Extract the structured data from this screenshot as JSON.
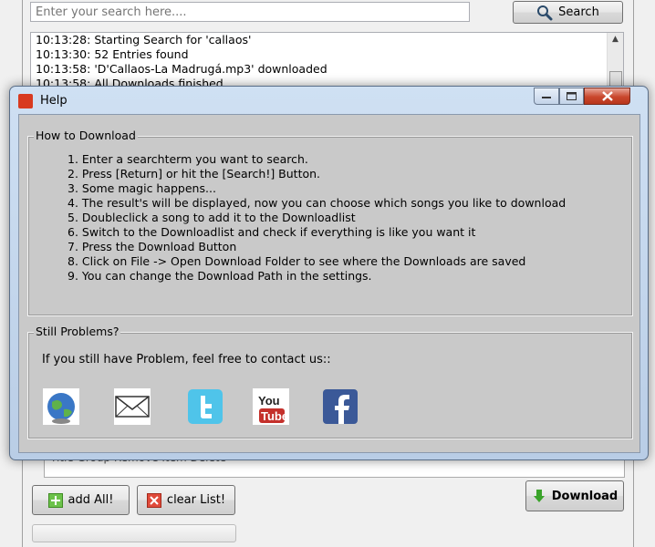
{
  "main": {
    "search": {
      "placeholder": "Enter your search here....",
      "button_label": "Search"
    },
    "log": [
      "10:13:28: Starting Search for 'callaos'",
      "10:13:30: 52 Entries found",
      "10:13:58: 'D'Callaos-La Madrugá.mp3' downloaded",
      "10:13:58: All Downloads finished"
    ],
    "results_header": "Title   Group   Remove Item   Delete",
    "add_all_label": "add All!",
    "clear_list_label": "clear List!",
    "download_label": "Download"
  },
  "help": {
    "title": "Help",
    "how_to": {
      "title": "How to Download",
      "steps": [
        "Enter a searchterm you want to search.",
        "Press [Return] or hit the [Search!] Button.",
        "Some magic happens...",
        "The result's will be displayed, now you can choose which songs you like to download",
        "Doubleclick a song to add it to the Downloadlist",
        "Switch to the Downloadlist and check if everything is like you want it",
        "Press the Download Button",
        "Click on File -> Open Download Folder to see where the Downloads are saved",
        "You can change the Download Path in the settings."
      ]
    },
    "problems": {
      "title": "Still Problems?",
      "text": "If you still have Problem, feel free to contact us::",
      "youtube_text_top": "You",
      "youtube_text_bottom": "Tube"
    }
  },
  "colors": {
    "facebook": "#3b5998",
    "twitter": "#4fc4ea",
    "youtube": "#c4302b",
    "close": "#c9462c"
  }
}
